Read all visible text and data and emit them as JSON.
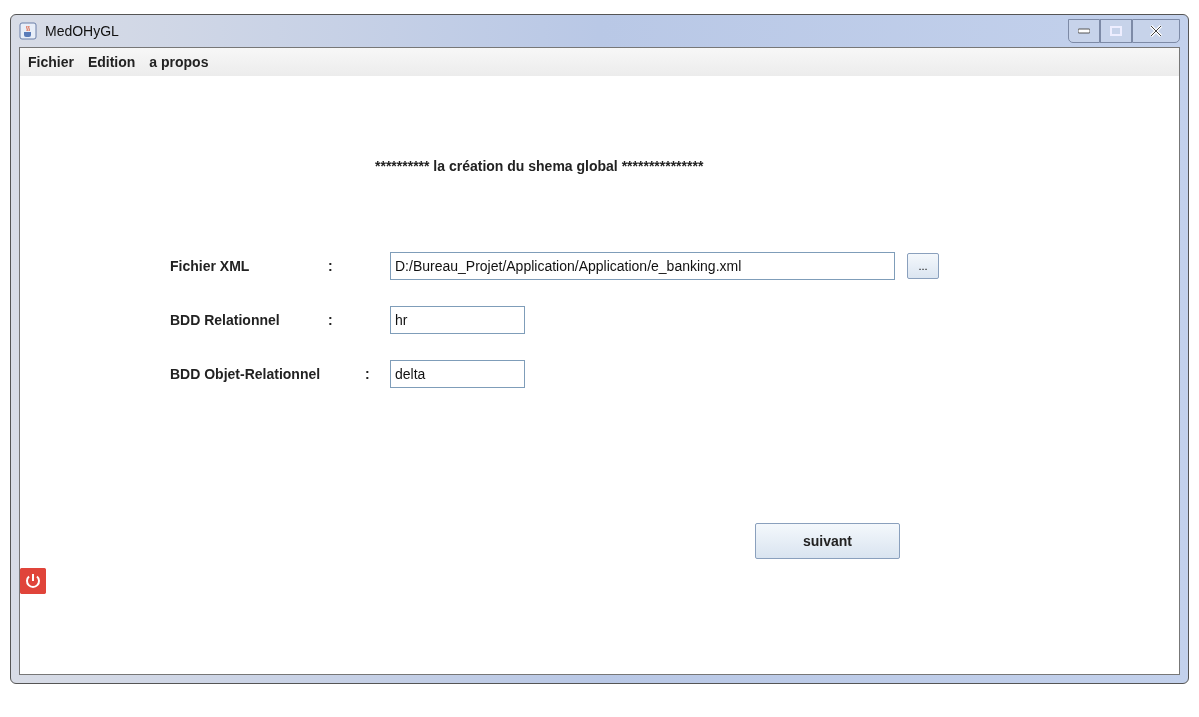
{
  "window": {
    "title": "MedOHyGL"
  },
  "menu": [
    "Fichier",
    "Edition",
    "a propos"
  ],
  "heading": "********** la création du shema global ***************",
  "fields": [
    {
      "label": "Fichier XML",
      "colon": ":",
      "value": "D:/Bureau_Projet/Application/Application/e_banking.xml",
      "kind": "file",
      "browse": "..."
    },
    {
      "label": "BDD Relationnel",
      "colon": ":",
      "value": "hr",
      "kind": "text"
    },
    {
      "label": "BDD Objet-Relationnel",
      "colon": ":",
      "value": "delta",
      "kind": "text"
    }
  ],
  "next_button": "suivant"
}
